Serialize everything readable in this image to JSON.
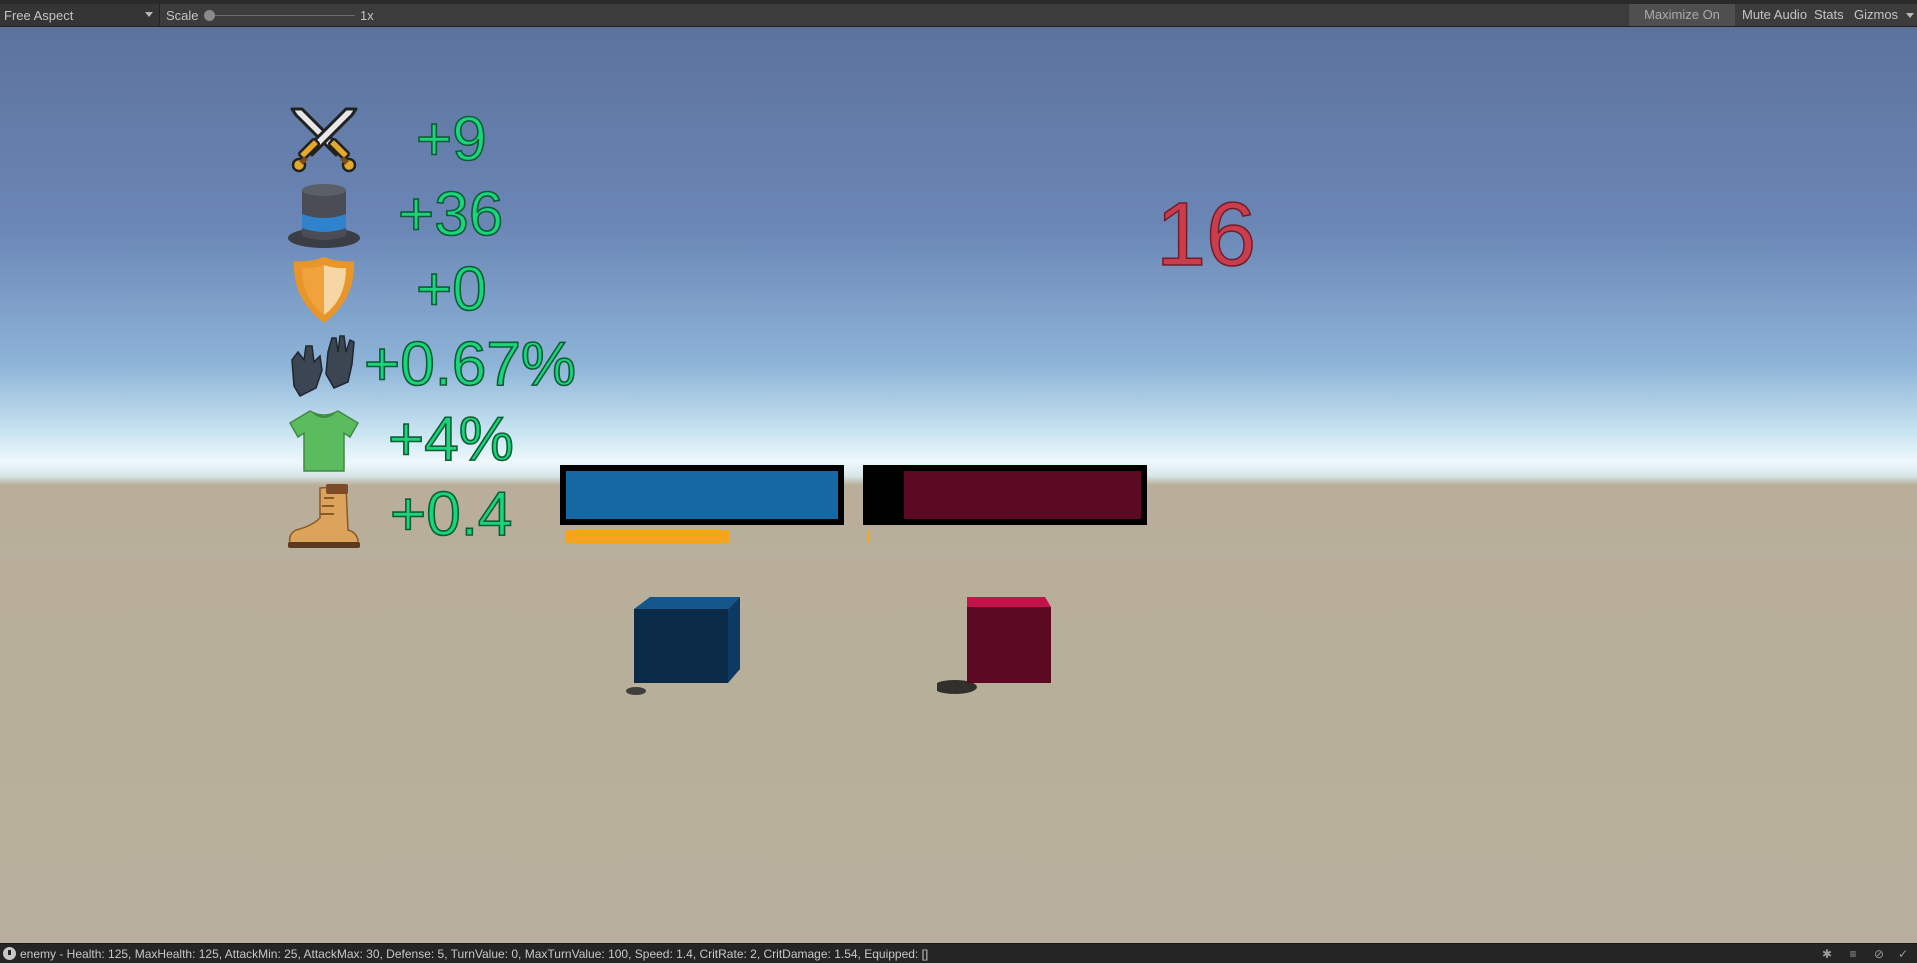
{
  "toolbar": {
    "aspect_label": "Free Aspect",
    "scale_label": "Scale",
    "scale_value": "1x",
    "maximize_label": "Maximize On Play",
    "mute_label": "Mute Audio",
    "stats_label": "Stats",
    "gizmos_label": "Gizmos"
  },
  "stats": [
    {
      "icon": "crossed-swords-icon",
      "value": "+9"
    },
    {
      "icon": "top-hat-icon",
      "value": "+36"
    },
    {
      "icon": "shield-icon",
      "value": "+0"
    },
    {
      "icon": "gloves-icon",
      "value": "+0.67%"
    },
    {
      "icon": "t-shirt-icon",
      "value": "+4%"
    },
    {
      "icon": "boot-icon",
      "value": "+0.4"
    }
  ],
  "turn_number": "16",
  "player": {
    "health_fraction": 1.0,
    "turn_fraction": 0.72,
    "bar_color": "#1568a4",
    "cube_color": "#0a2a48"
  },
  "enemy": {
    "health_fraction": 0.87,
    "turn_fraction": 0.01,
    "bar_color": "#5c0a24",
    "cube_color": "#5c0a24"
  },
  "turn_bar_color": "#f6a51a",
  "status_bar": {
    "message": "enemy - Health: 125, MaxHealth: 125, AttackMin: 25, AttackMax: 30, Defense: 5, TurnValue: 0, MaxTurnValue: 100, Speed: 1.4, CritRate: 2, CritDamage: 1.54, Equipped: []"
  }
}
